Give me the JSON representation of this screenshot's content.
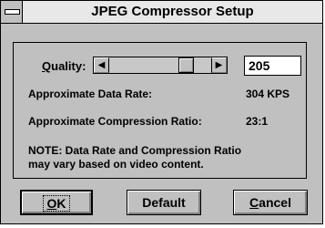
{
  "window": {
    "title": "JPEG Compressor Setup"
  },
  "quality": {
    "label_mnemonic": "Q",
    "label_rest": "uality:",
    "value": "205",
    "slider_level_percent": 80
  },
  "data_rate": {
    "label": "Approximate Data Rate:",
    "value": "304 KPS"
  },
  "compression": {
    "label": "Approximate Compression Ratio:",
    "value": "23:1"
  },
  "note": {
    "line1": "NOTE: Data Rate and Compression Ratio",
    "line2": "may vary based on video content."
  },
  "buttons": {
    "ok_mnemonic": "O",
    "ok_rest": "K",
    "default_label": "Default",
    "cancel_mnemonic": "C",
    "cancel_rest": "ancel"
  },
  "icons": {
    "system_menu": "system-menu-icon",
    "left": "left-arrow-icon",
    "right": "right-arrow-icon"
  }
}
